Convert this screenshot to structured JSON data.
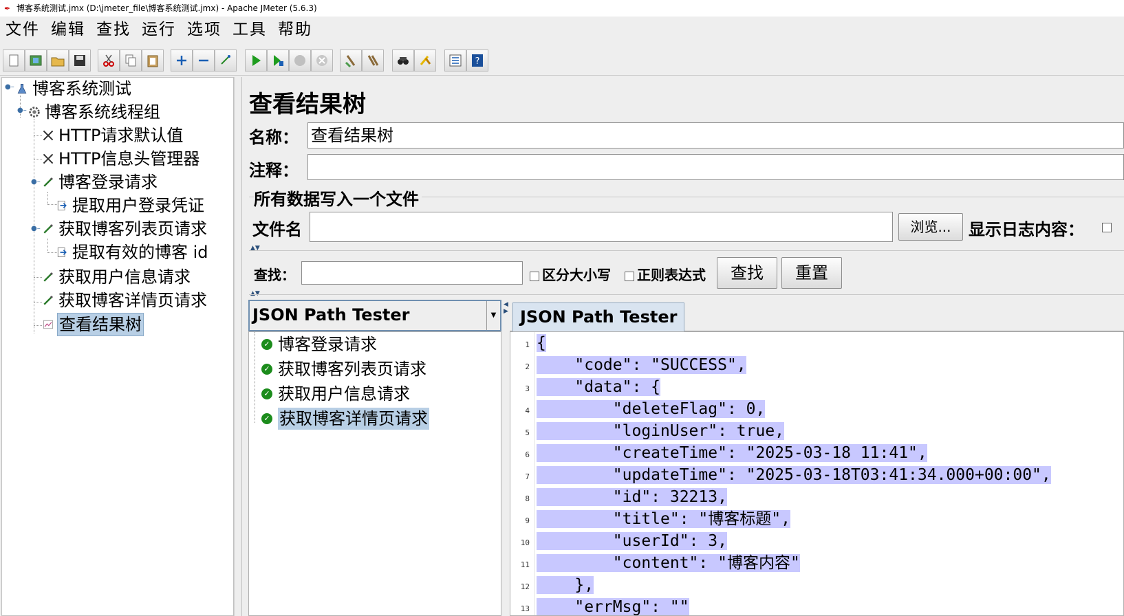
{
  "window": {
    "title": "博客系统测试.jmx (D:\\jmeter_file\\博客系统测试.jmx) - Apache JMeter (5.6.3)"
  },
  "menu": [
    "文件",
    "编辑",
    "查找",
    "运行",
    "选项",
    "工具",
    "帮助"
  ],
  "toolbar": {
    "icons": [
      "new-icon",
      "templates-icon",
      "open-icon",
      "save-icon",
      "cut-icon",
      "copy-icon",
      "paste-icon",
      "expand-icon",
      "collapse-icon",
      "toggle-icon",
      "start-icon",
      "start-no-pause-icon",
      "stop-icon",
      "shutdown-icon",
      "clear-icon",
      "clear-all-icon",
      "search-icon",
      "reset-search-icon",
      "function-helper-icon",
      "help-icon"
    ]
  },
  "tree": {
    "nodes": [
      {
        "label": "博客系统测试",
        "icon": "test-plan-icon"
      },
      {
        "label": "博客系统线程组",
        "icon": "thread-group-icon"
      },
      {
        "label": "HTTP请求默认值",
        "icon": "config-element-icon"
      },
      {
        "label": "HTTP信息头管理器",
        "icon": "config-element-icon"
      },
      {
        "label": "博客登录请求",
        "icon": "sampler-icon"
      },
      {
        "label": "提取用户登录凭证",
        "icon": "post-processor-icon"
      },
      {
        "label": "获取博客列表页请求",
        "icon": "sampler-icon"
      },
      {
        "label": "提取有效的博客 id",
        "icon": "post-processor-icon"
      },
      {
        "label": "获取用户信息请求",
        "icon": "sampler-icon"
      },
      {
        "label": "获取博客详情页请求",
        "icon": "sampler-icon"
      },
      {
        "label": "查看结果树",
        "icon": "listener-icon"
      }
    ]
  },
  "panel": {
    "title": "查看结果树",
    "name_label": "名称：",
    "name_value": "查看结果树",
    "comment_label": "注释：",
    "comment_value": "",
    "file_group_title": "所有数据写入一个文件",
    "filename_label": "文件名",
    "filename_value": "",
    "browse_button": "浏览...",
    "log_label": "显示日志内容：",
    "search_label": "查找：",
    "search_value": "",
    "case_sensitive": "区分大小写",
    "regex": "正则表达式",
    "find_button": "查找",
    "reset_button": "重置"
  },
  "renderer": {
    "selected": "JSON Path Tester",
    "tab_label": "JSON Path Tester"
  },
  "results": [
    {
      "label": "博客登录请求",
      "status": "success"
    },
    {
      "label": "获取博客列表页请求",
      "status": "success"
    },
    {
      "label": "获取用户信息请求",
      "status": "success"
    },
    {
      "label": "获取博客详情页请求",
      "status": "success"
    }
  ],
  "json_view": {
    "lines": [
      {
        "n": "1",
        "text": "{"
      },
      {
        "n": "2",
        "text": "    \"code\": \"SUCCESS\","
      },
      {
        "n": "3",
        "text": "    \"data\": {"
      },
      {
        "n": "4",
        "text": "        \"deleteFlag\": 0,"
      },
      {
        "n": "5",
        "text": "        \"loginUser\": true,"
      },
      {
        "n": "6",
        "text": "        \"createTime\": \"2025-03-18 11:41\","
      },
      {
        "n": "7",
        "text": "        \"updateTime\": \"2025-03-18T03:41:34.000+00:00\","
      },
      {
        "n": "8",
        "text": "        \"id\": 32213,"
      },
      {
        "n": "9",
        "text": "        \"title\": \"博客标题\","
      },
      {
        "n": "10",
        "text": "        \"userId\": 3,"
      },
      {
        "n": "11",
        "text": "        \"content\": \"博客内容\""
      },
      {
        "n": "12",
        "text": "    },"
      },
      {
        "n": "13",
        "text": "    \"errMsg\": \"\""
      }
    ]
  }
}
